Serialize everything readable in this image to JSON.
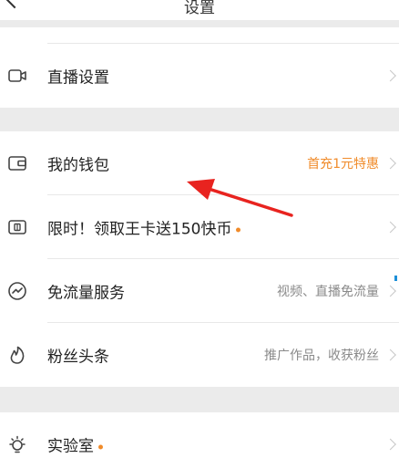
{
  "header": {
    "title": "设置"
  },
  "rows": {
    "live": {
      "label": "直播设置",
      "icon": "video-camera-icon"
    },
    "wallet": {
      "label": "我的钱包",
      "value": "首充1元特惠",
      "icon": "wallet-icon"
    },
    "kingcard": {
      "label": "限时！领取王卡送150快币",
      "icon": "sim-card-icon",
      "has_dot": true
    },
    "dataflow": {
      "label": "免流量服务",
      "value": "视频、直播免流量",
      "icon": "speedometer-icon"
    },
    "fans": {
      "label": "粉丝头条",
      "value": "推广作品，收获粉丝",
      "icon": "flame-icon"
    },
    "lab": {
      "label": "实验室",
      "icon": "lightbulb-icon",
      "has_dot": true
    }
  },
  "colors": {
    "accent_orange": "#f08b2a",
    "annotation_arrow": "#e8231f",
    "background": "#ebebeb"
  }
}
